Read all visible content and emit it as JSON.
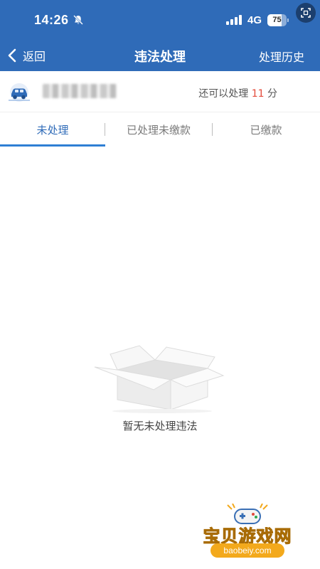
{
  "status_bar": {
    "time": "14:26",
    "network": "4G",
    "battery_text": "75",
    "battery_level": 0.75,
    "icons": [
      "bell-slash-icon",
      "signal-icon",
      "battery-icon",
      "scan-icon"
    ]
  },
  "nav": {
    "back_label": "返回",
    "title": "违法处理",
    "history_label": "处理历史"
  },
  "vehicle": {
    "plate": "",
    "remaining_prefix": "还可以处理",
    "remaining_count": "11",
    "remaining_suffix": "分",
    "icon": "car-icon"
  },
  "tabs": [
    {
      "label": "未处理",
      "active": true
    },
    {
      "label": "已处理未缴款",
      "active": false
    },
    {
      "label": "已缴款",
      "active": false
    }
  ],
  "empty": {
    "text": "暂无未处理违法",
    "icon": "empty-box-icon"
  },
  "watermark": {
    "title": "宝贝游戏网",
    "url": "baobeiy.com"
  },
  "colors": {
    "header": "#2f6bb8",
    "tab_active": "#2f6bb8",
    "tab_indicator": "#2f7fd4",
    "remaining_count": "#e34a3a",
    "watermark": "#f3a91c"
  }
}
